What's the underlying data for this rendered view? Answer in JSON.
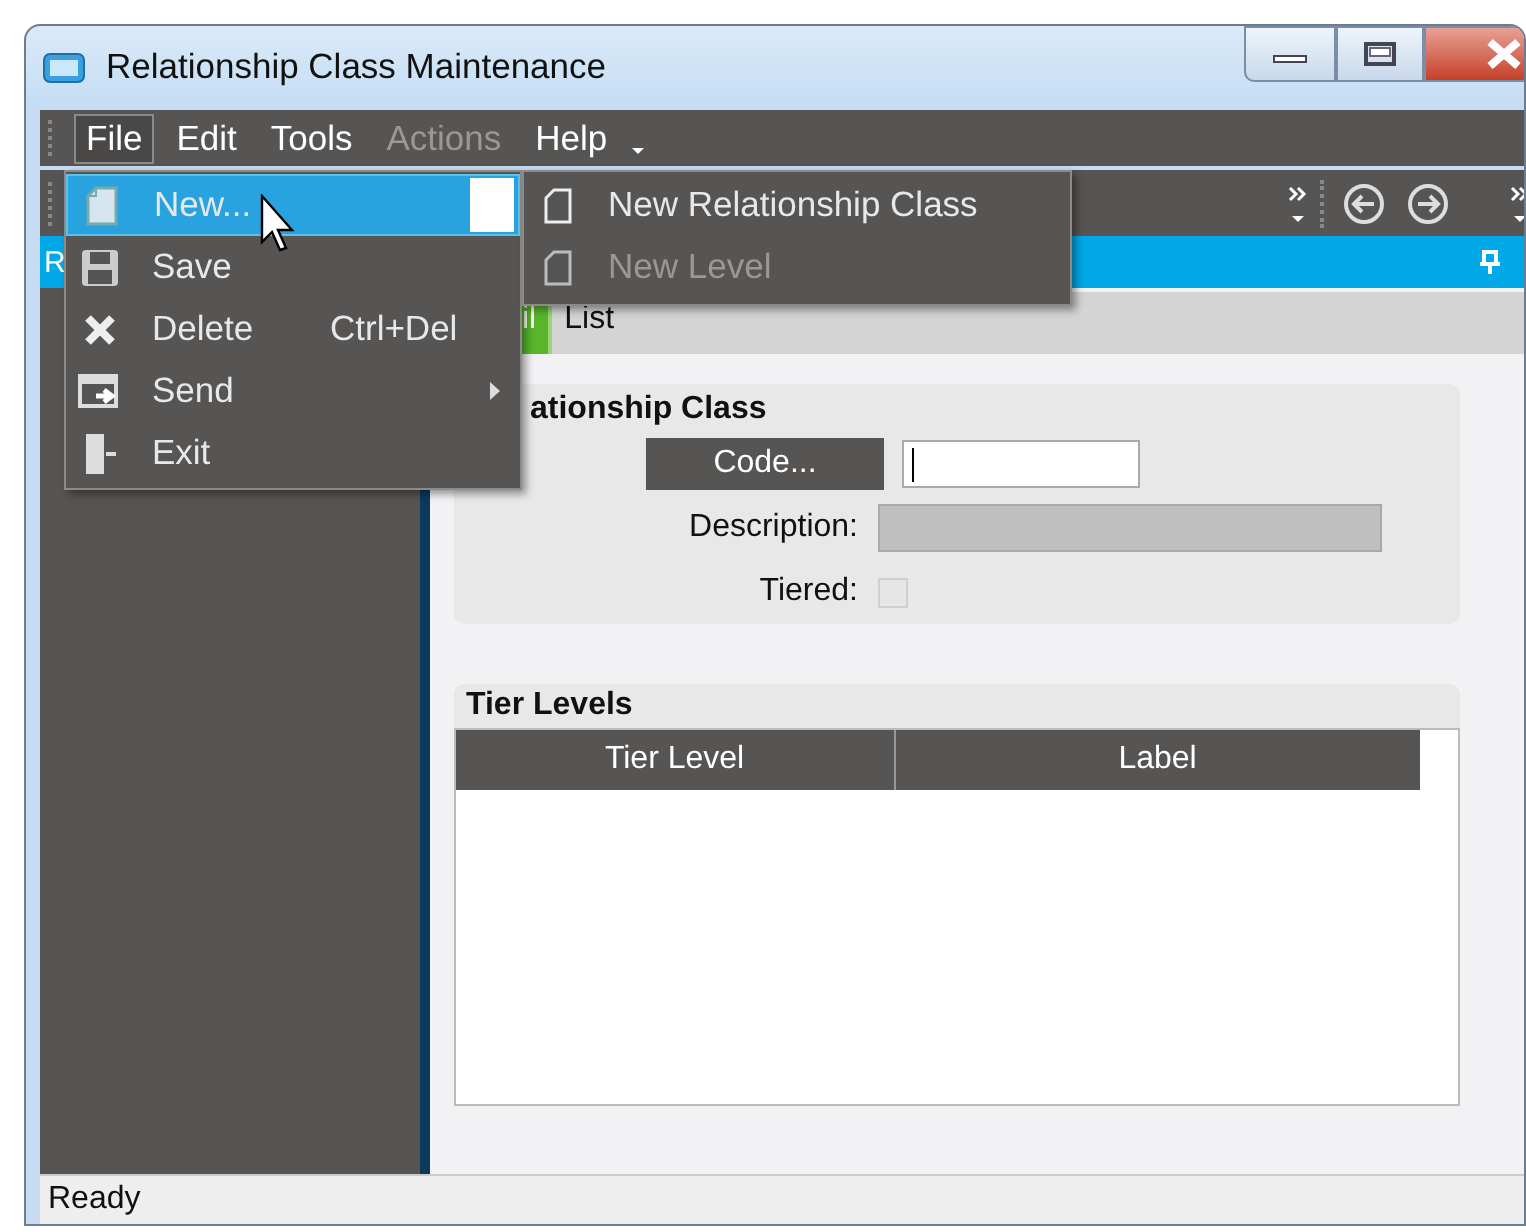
{
  "window": {
    "title": "Relationship Class Maintenance"
  },
  "menu_bar": [
    {
      "label": "File",
      "selected": true,
      "disabled": false
    },
    {
      "label": "Edit",
      "selected": false,
      "disabled": false
    },
    {
      "label": "Tools",
      "selected": false,
      "disabled": false
    },
    {
      "label": "Actions",
      "selected": false,
      "disabled": true
    },
    {
      "label": "Help",
      "selected": false,
      "disabled": false
    }
  ],
  "file_menu": [
    {
      "label": "New...",
      "selected": true,
      "has_submenu": true
    },
    {
      "label": "Save",
      "selected": false,
      "has_submenu": false
    },
    {
      "label": "Delete",
      "shortcut": "Ctrl+Del",
      "selected": false,
      "has_submenu": false
    },
    {
      "label": "Send",
      "selected": false,
      "has_submenu": true
    },
    {
      "label": "Exit",
      "selected": false,
      "has_submenu": false
    }
  ],
  "new_submenu": [
    {
      "label": "New Relationship Class",
      "disabled": false
    },
    {
      "label": "New Level",
      "disabled": true
    }
  ],
  "panel_header": {
    "title": "R"
  },
  "tabs": [
    {
      "label": "il",
      "selected": true
    },
    {
      "label": "List",
      "selected": false
    }
  ],
  "form": {
    "title": "ationship Class",
    "code_button": "Code...",
    "code_focused": true,
    "description_label": "Description:",
    "description_disabled": true,
    "tiered_label": "Tiered:",
    "tiered_checked": false,
    "tiered_disabled": true
  },
  "tier_levels": {
    "title": "Tier Levels",
    "columns": [
      "Tier Level",
      "Label"
    ]
  },
  "status_bar": {
    "text": "Ready"
  }
}
